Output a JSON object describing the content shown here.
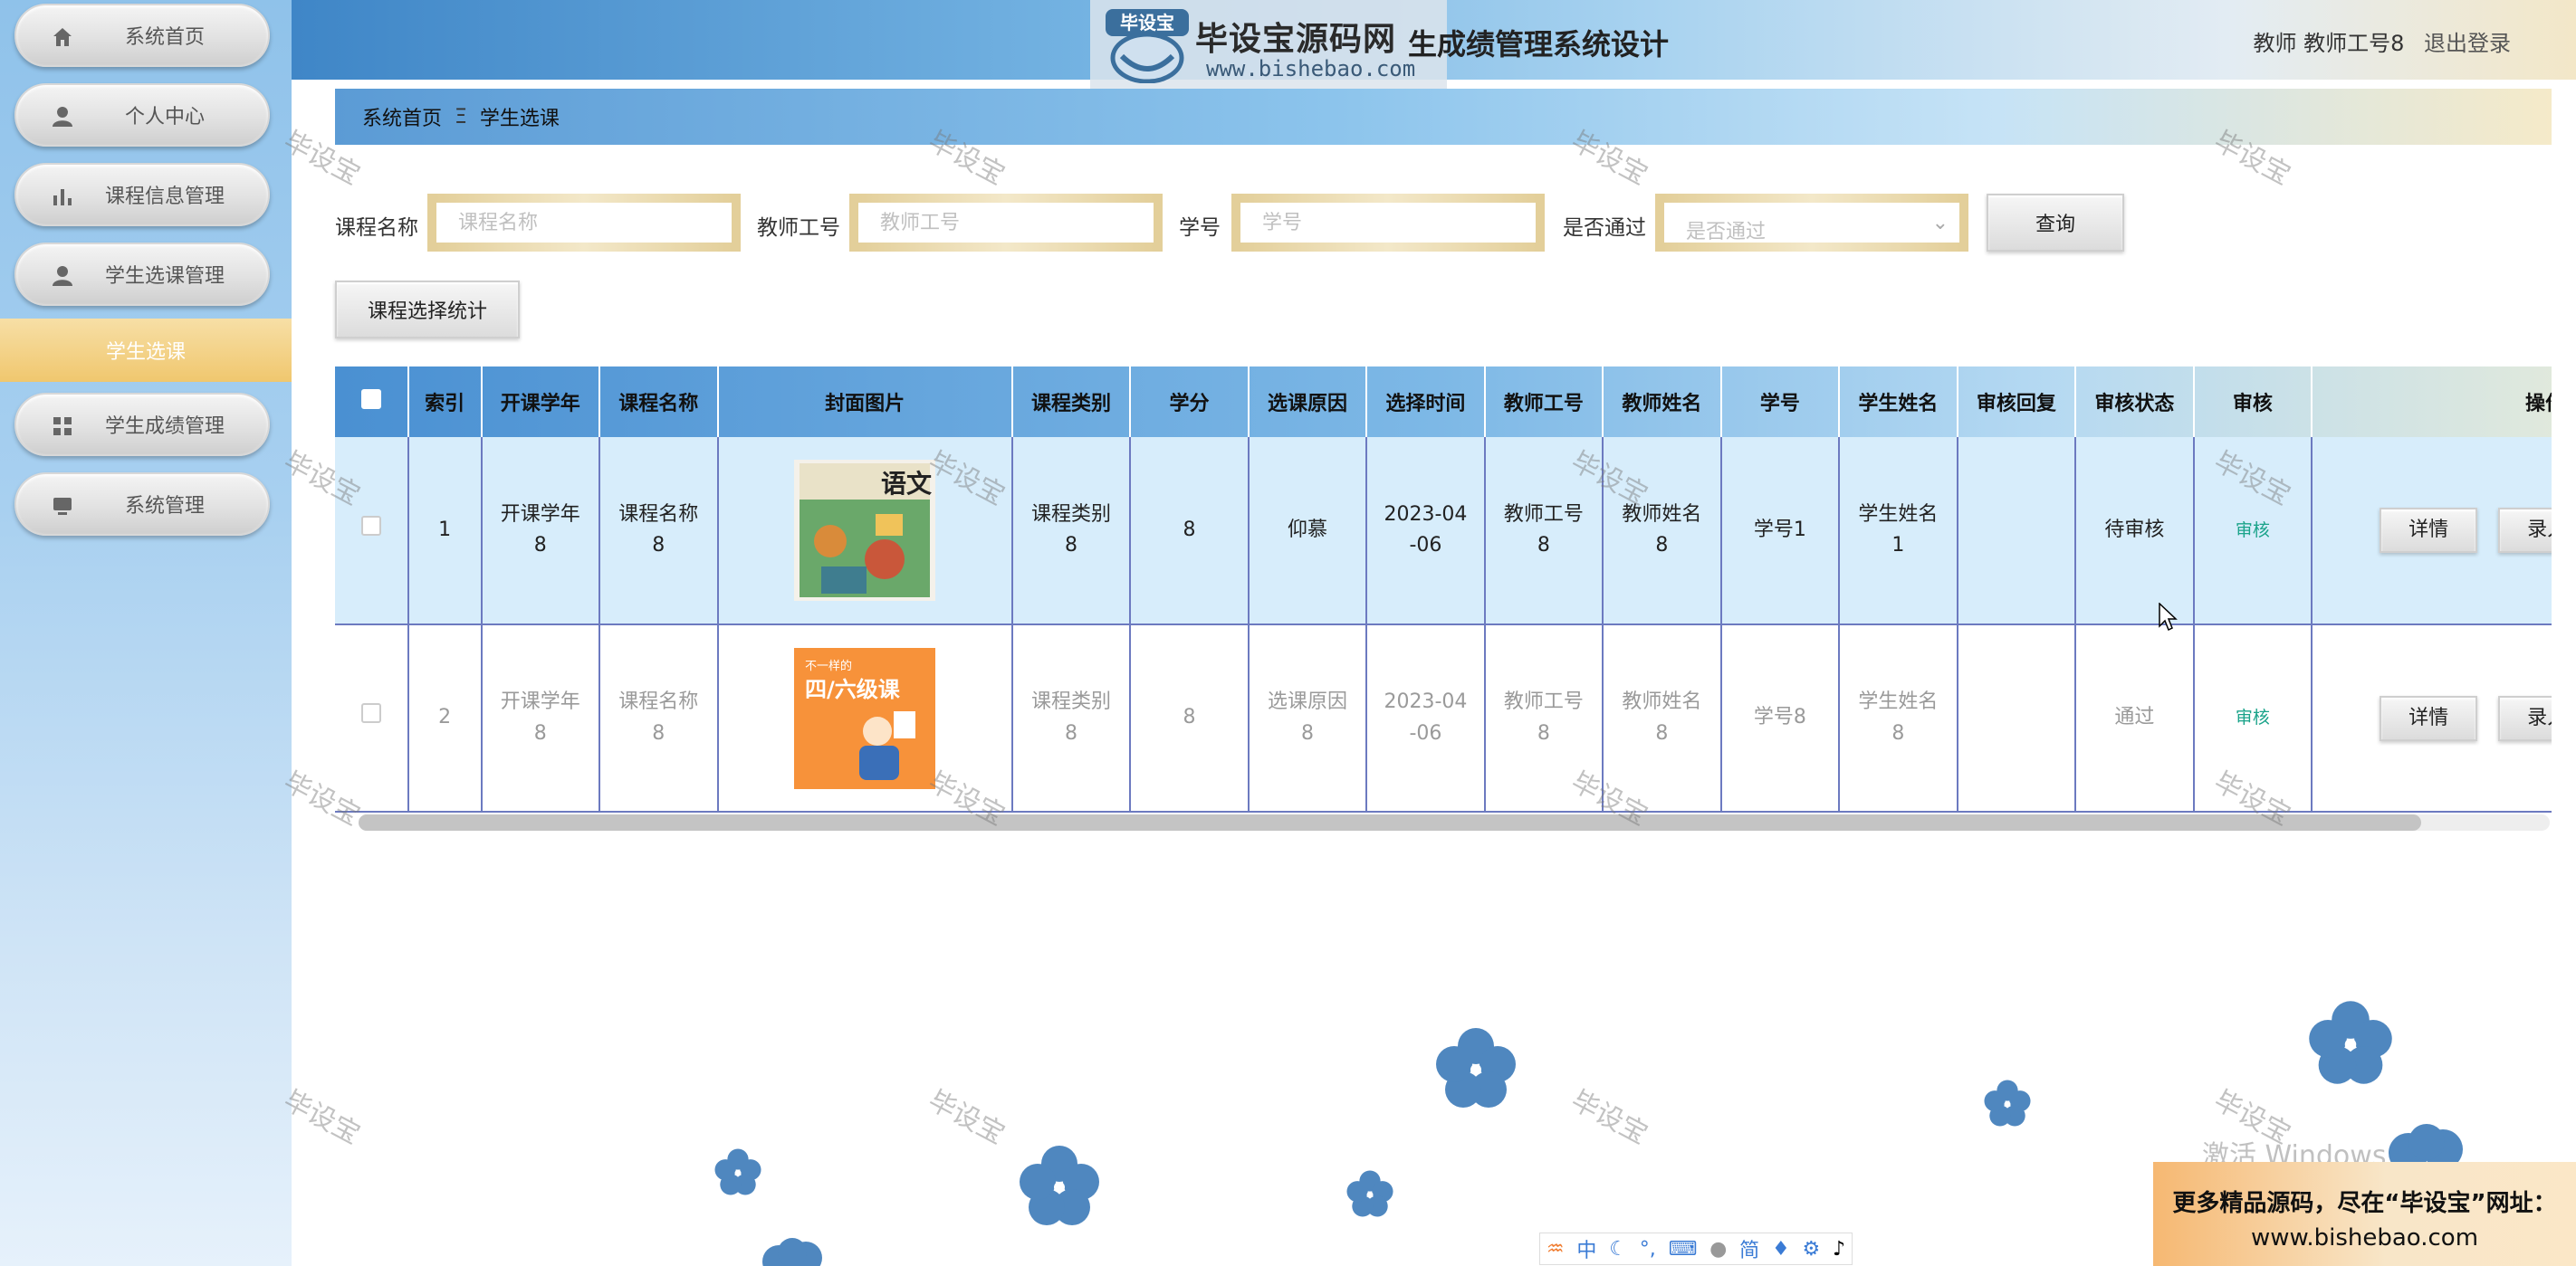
{
  "sidebar": {
    "items": [
      {
        "label": "系统首页",
        "icon": "home-icon"
      },
      {
        "label": "个人中心",
        "icon": "user-icon"
      },
      {
        "label": "课程信息管理",
        "icon": "bar-chart-icon"
      },
      {
        "label": "学生选课管理",
        "icon": "user-icon"
      },
      {
        "label": "学生成绩管理",
        "icon": "grid-icon"
      },
      {
        "label": "系统管理",
        "icon": "monitor-icon"
      }
    ],
    "active_sub": "学生选课"
  },
  "header": {
    "logo_badge": "毕设宝",
    "logo_text": "毕设宝源码网",
    "logo_url": "www.bishebao.com",
    "title": "生成绩管理系统设计",
    "user_label": "教师 教师工号8",
    "logout": "退出登录"
  },
  "breadcrumb": {
    "home": "系统首页",
    "sep": "Ξ",
    "current": "学生选课"
  },
  "search": {
    "course_label": "课程名称",
    "course_placeholder": "课程名称",
    "teacher_label": "教师工号",
    "teacher_placeholder": "教师工号",
    "student_label": "学号",
    "student_placeholder": "学号",
    "pass_label": "是否通过",
    "pass_placeholder": "是否通过",
    "query_button": "查询"
  },
  "stat_button": "课程选择统计",
  "table": {
    "headers": [
      "索引",
      "开课学年",
      "课程名称",
      "封面图片",
      "课程类别",
      "学分",
      "选课原因",
      "选择时间",
      "教师工号",
      "教师姓名",
      "学号",
      "学生姓名",
      "审核回复",
      "审核状态",
      "审核",
      "操作"
    ],
    "rows": [
      {
        "index": "1",
        "year": "开课学年\n8",
        "course": "课程名称\n8",
        "category": "课程类别\n8",
        "credit": "8",
        "reason": "仰慕",
        "time": "2023-04\n-06",
        "teacher_no": "教师工号\n8",
        "teacher_name": "教师姓名\n8",
        "student_no": "学号1",
        "student_name": "学生姓名\n1",
        "reply": "",
        "status": "待审核",
        "audit": "审核",
        "detail": "详情",
        "enter": "录入成绩"
      },
      {
        "index": "2",
        "year": "开课学年\n8",
        "course": "课程名称\n8",
        "category": "课程类别\n8",
        "credit": "8",
        "reason": "选课原因\n8",
        "time": "2023-04\n-06",
        "teacher_no": "教师工号\n8",
        "teacher_name": "教师姓名\n8",
        "student_no": "学号8",
        "student_name": "学生姓名\n8",
        "reply": "",
        "status": "通过",
        "audit": "审核",
        "detail": "详情",
        "enter": "录入成绩"
      }
    ],
    "cover1_text": "语文",
    "cover2_text_top": "不一样的",
    "cover2_text_main": "四/六级课"
  },
  "watermark": "毕设宝",
  "windows_activation": "激活 Windows",
  "ime": {
    "items": [
      "中",
      "简"
    ]
  },
  "ad": {
    "line1": "更多精品源码，尽在“毕设宝”网址：",
    "line2": "www.bishebao.com"
  },
  "colors": {
    "accent": "#5b9bd5",
    "active_menu": "#f0c76e",
    "audit_link": "#1aa38a",
    "flower": "#4f87bf"
  }
}
